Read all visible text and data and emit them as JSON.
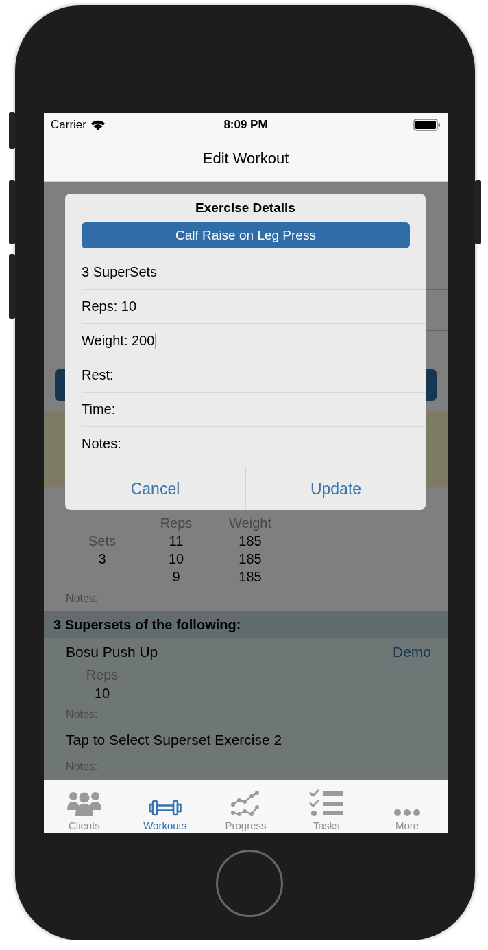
{
  "status_bar": {
    "carrier": "Carrier",
    "time": "8:09 PM"
  },
  "nav_bar": {
    "title": "Edit Workout"
  },
  "background": {
    "exercise": {
      "sets_label": "Sets",
      "sets": "3",
      "columns": [
        {
          "header": "Reps",
          "values": [
            "11",
            "10",
            "9"
          ]
        },
        {
          "header": "Weight",
          "values": [
            "185",
            "185",
            "185"
          ]
        }
      ],
      "notes": "Notes:"
    },
    "superset": {
      "title": "3 Supersets of the following:",
      "exercises": [
        {
          "name": "Bosu Push Up",
          "demo": "Demo",
          "reps_header": "Reps",
          "reps": "10",
          "notes": "Notes:"
        },
        {
          "name": "Tap to Select Superset Exercise 2",
          "notes": "Notes:"
        }
      ]
    }
  },
  "dialog": {
    "title": "Exercise Details",
    "exercise_button": "Calf Raise on Leg Press",
    "fields": [
      {
        "text": "3 SuperSets",
        "focused": false
      },
      {
        "text": "Reps: 10",
        "focused": false
      },
      {
        "text": "Weight: 200",
        "focused": true
      },
      {
        "text": "Rest:",
        "focused": false
      },
      {
        "text": "Time:",
        "focused": false
      },
      {
        "text": "Notes:",
        "focused": false
      }
    ],
    "buttons": [
      "Cancel",
      "Update"
    ]
  },
  "tab_bar": [
    {
      "label": "Clients",
      "kind": "people",
      "selected": false
    },
    {
      "label": "Workouts",
      "kind": "dumbbell",
      "selected": true
    },
    {
      "label": "Progress",
      "kind": "chart",
      "selected": false
    },
    {
      "label": "Tasks",
      "kind": "checklist",
      "selected": false
    },
    {
      "label": "More",
      "kind": "dots",
      "selected": false
    }
  ]
}
